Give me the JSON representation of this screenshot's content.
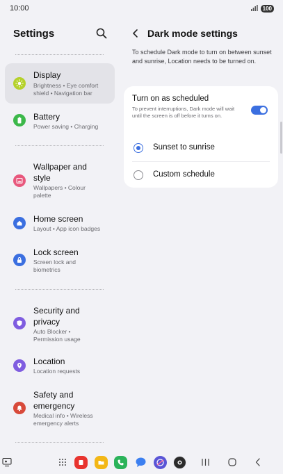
{
  "status_bar": {
    "time": "10:00",
    "battery": "100"
  },
  "left_pane": {
    "title": "Settings",
    "items": [
      {
        "label": "Display",
        "sub": "Brightness • Eye comfort shield • Navigation bar",
        "icon": "sun-icon",
        "color": "#b5d12b"
      },
      {
        "label": "Battery",
        "sub": "Power saving • Charging",
        "icon": "battery-icon",
        "color": "#3cb84a"
      },
      {
        "label": "Wallpaper and style",
        "sub": "Wallpapers • Colour palette",
        "icon": "image-icon",
        "color": "#e8587d"
      },
      {
        "label": "Home screen",
        "sub": "Layout • App icon badges",
        "icon": "home-icon",
        "color": "#3b6fe0"
      },
      {
        "label": "Lock screen",
        "sub": "Screen lock and biometrics",
        "icon": "lock-icon",
        "color": "#3b6fe0"
      },
      {
        "label": "Security and privacy",
        "sub": "Auto Blocker • Permission usage",
        "icon": "shield-icon",
        "color": "#7f5de0"
      },
      {
        "label": "Location",
        "sub": "Location requests",
        "icon": "location-pin-icon",
        "color": "#7f5de0"
      },
      {
        "label": "Safety and emergency",
        "sub": "Medical info • Wireless emergency alerts",
        "icon": "alert-icon",
        "color": "#d84a3a"
      }
    ]
  },
  "right_pane": {
    "title": "Dark mode settings",
    "info": "To schedule Dark mode to turn on between sunset and sunrise, Location needs to be turned on.",
    "scheduled": {
      "label": "Turn on as scheduled",
      "sub": "To prevent interruptions, Dark mode will wait until the screen is off before it turns on.",
      "enabled": true
    },
    "options": [
      {
        "label": "Sunset to sunrise",
        "selected": true
      },
      {
        "label": "Custom schedule",
        "selected": false
      }
    ]
  },
  "bottom_bar": {
    "apps": [
      "samsung-notes-icon",
      "my-files-icon",
      "phone-icon",
      "messages-icon",
      "internet-icon",
      "camera-icon"
    ]
  }
}
